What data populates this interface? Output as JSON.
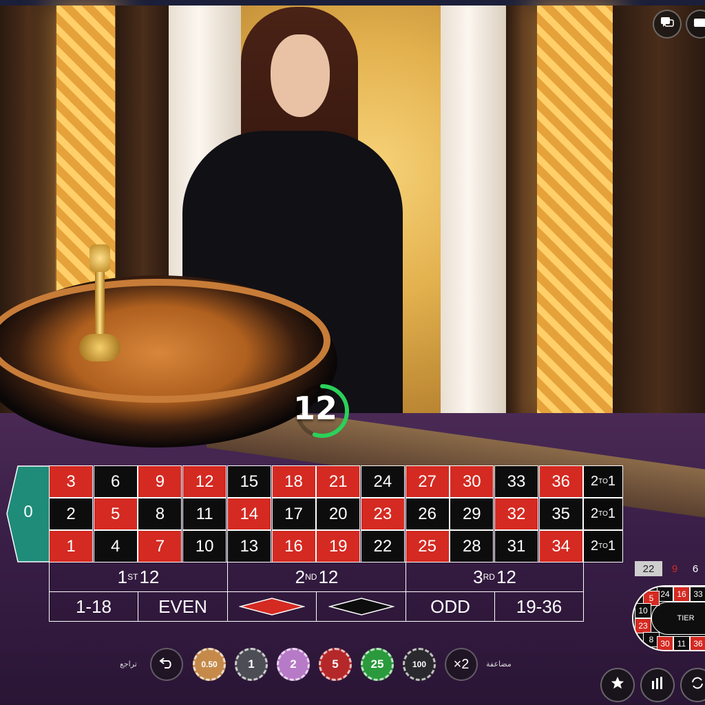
{
  "timer": {
    "seconds": "12",
    "progress": 0.55
  },
  "top_controls": {
    "chat_icon": "chat-icon",
    "video_icon": "video-icon"
  },
  "zero": "0",
  "grid": {
    "rows": [
      [
        {
          "n": "3",
          "c": "red"
        },
        {
          "n": "6",
          "c": "black"
        },
        {
          "n": "9",
          "c": "red"
        },
        {
          "n": "12",
          "c": "red"
        },
        {
          "n": "15",
          "c": "black"
        },
        {
          "n": "18",
          "c": "red"
        },
        {
          "n": "21",
          "c": "red"
        },
        {
          "n": "24",
          "c": "black"
        },
        {
          "n": "27",
          "c": "red"
        },
        {
          "n": "30",
          "c": "red"
        },
        {
          "n": "33",
          "c": "black"
        },
        {
          "n": "36",
          "c": "red"
        }
      ],
      [
        {
          "n": "2",
          "c": "black"
        },
        {
          "n": "5",
          "c": "red"
        },
        {
          "n": "8",
          "c": "black"
        },
        {
          "n": "11",
          "c": "black"
        },
        {
          "n": "14",
          "c": "red"
        },
        {
          "n": "17",
          "c": "black"
        },
        {
          "n": "20",
          "c": "black"
        },
        {
          "n": "23",
          "c": "red"
        },
        {
          "n": "26",
          "c": "black"
        },
        {
          "n": "29",
          "c": "black"
        },
        {
          "n": "32",
          "c": "red"
        },
        {
          "n": "35",
          "c": "black"
        }
      ],
      [
        {
          "n": "1",
          "c": "red"
        },
        {
          "n": "4",
          "c": "black"
        },
        {
          "n": "7",
          "c": "red"
        },
        {
          "n": "10",
          "c": "black"
        },
        {
          "n": "13",
          "c": "black"
        },
        {
          "n": "16",
          "c": "red"
        },
        {
          "n": "19",
          "c": "red"
        },
        {
          "n": "22",
          "c": "black"
        },
        {
          "n": "25",
          "c": "red"
        },
        {
          "n": "28",
          "c": "black"
        },
        {
          "n": "31",
          "c": "black"
        },
        {
          "n": "34",
          "c": "red"
        }
      ]
    ],
    "column_bet": {
      "a": "2",
      "sup": "TO",
      "b": "1"
    }
  },
  "dozens": [
    {
      "num": "1",
      "sup": "ST",
      "rest": " 12"
    },
    {
      "num": "2",
      "sup": "ND",
      "rest": " 12"
    },
    {
      "num": "3",
      "sup": "RD",
      "rest": " 12"
    }
  ],
  "outside": {
    "low": "1-18",
    "even": "EVEN",
    "odd": "ODD",
    "high": "19-36"
  },
  "colors": {
    "red": "#d42a22",
    "black": "#0d0d0d",
    "zero_green": "#1f8c7a",
    "timer_green": "#2bd15a"
  },
  "controls": {
    "undo_label": "تراجع",
    "double_label": "مضاعفة",
    "double_text": "×2"
  },
  "chips": [
    {
      "value": "0.50",
      "color": "#c58a4a"
    },
    {
      "value": "1",
      "color": "#4d4d55"
    },
    {
      "value": "2",
      "color": "#b77ac7"
    },
    {
      "value": "5",
      "color": "#b5282a"
    },
    {
      "value": "25",
      "color": "#2a9a3c"
    },
    {
      "value": "100",
      "color": "#2a2a2e"
    }
  ],
  "history": [
    {
      "n": "22",
      "c": "#cfcfcf"
    },
    {
      "n": "9",
      "c": "#d42a22"
    },
    {
      "n": "6",
      "c": "#ffffff"
    }
  ],
  "racetrack": {
    "top": [
      {
        "n": "24",
        "c": "black"
      },
      {
        "n": "16",
        "c": "red"
      },
      {
        "n": "33",
        "c": "black"
      }
    ],
    "left": [
      {
        "n": "5",
        "c": "red"
      },
      {
        "n": "10",
        "c": "black"
      },
      {
        "n": "23",
        "c": "red"
      },
      {
        "n": "8",
        "c": "black"
      }
    ],
    "bottom": [
      {
        "n": "30",
        "c": "red"
      },
      {
        "n": "11",
        "c": "black"
      },
      {
        "n": "36",
        "c": "red"
      }
    ],
    "center_label": "TIER"
  }
}
